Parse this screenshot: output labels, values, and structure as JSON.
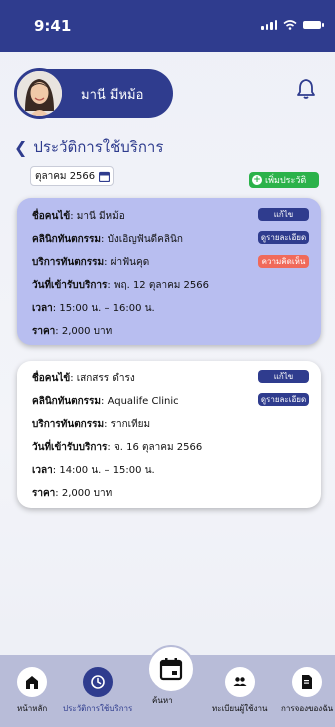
{
  "status": {
    "time": "9:41"
  },
  "profile": {
    "name": "มานี มีหม้อ"
  },
  "page": {
    "title": "ประวัติการใช้บริการ",
    "month": "ตุลาคม 2566",
    "add_label": "เพิ่มประวัติ"
  },
  "records": [
    {
      "patient_label": "ชื่อคนไข้",
      "patient": ": มานี มีหม้อ",
      "clinic_label": "คลินิกทันตกรรม",
      "clinic": ": บังเอิญฟันดีคลินิก",
      "service_label": "บริการทันตกรรม",
      "service": ": ผ่าฟันคุด",
      "date_label": "วันที่เข้ารับบริการ",
      "date": ": พฤ. 12 ตุลาคม 2566",
      "time_label": "เวลา",
      "time": ": 15:00 น. – 16:00 น.",
      "price_label": "ราคา",
      "price": ": 2,000 บาท",
      "edit": "แก้ไข",
      "detail": "ดูรายละเอียด",
      "feedback": "ความคิดเห็น"
    },
    {
      "patient_label": "ชื่อคนไข้",
      "patient": ": เสกสรร ดำรง",
      "clinic_label": "คลินิกทันตกรรม",
      "clinic": ": Aqualife Clinic",
      "service_label": "บริการทันตกรรม",
      "service": ": รากเทียม",
      "date_label": "วันที่เข้ารับบริการ",
      "date": ": จ. 16 ตุลาคม 2566",
      "time_label": "เวลา",
      "time": ": 14:00 น. – 15:00 น.",
      "price_label": "ราคา",
      "price": ": 2,000 บาท",
      "edit": "แก้ไข",
      "detail": "ดูรายละเอียด"
    }
  ],
  "nav": {
    "home": "หน้าหลัก",
    "history": "ประวัติการใช้บริการ",
    "search": "ค้นหา",
    "register": "ทะเบียนผู้ใช้งาน",
    "booking": "การจองของฉัน"
  },
  "colors": {
    "primary": "#2f3c8e",
    "card_active": "#b8bef0",
    "add": "#2bb24a",
    "feedback": "#f06a5a",
    "nav": "#b8bcd8"
  }
}
